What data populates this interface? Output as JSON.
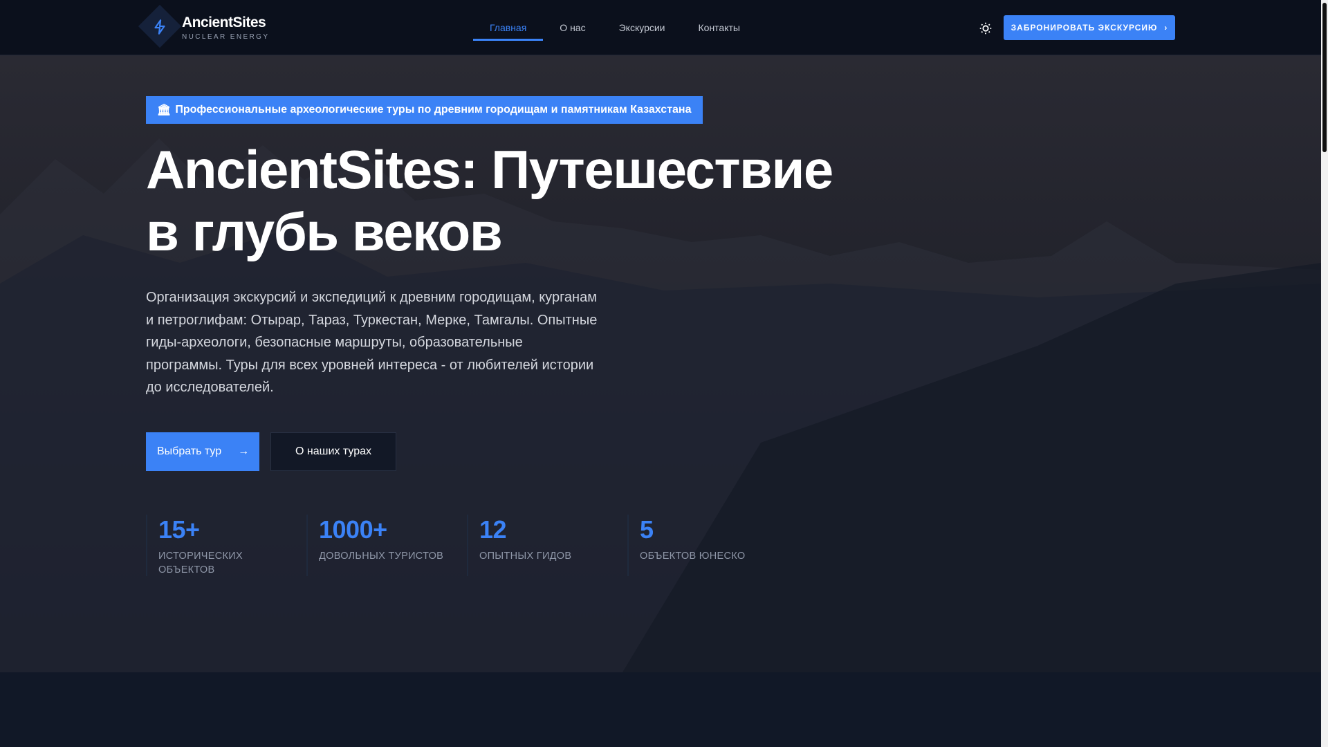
{
  "header": {
    "logo_title": "AncientSites",
    "logo_subtitle": "NUCLEAR ENERGY",
    "nav": [
      {
        "label": "Главная",
        "active": true
      },
      {
        "label": "О нас"
      },
      {
        "label": "Экскурсии"
      },
      {
        "label": "Контакты"
      }
    ],
    "cta_label": "ЗАБРОНИРОВАТЬ ЭКСКУРСИЮ"
  },
  "hero": {
    "badge_icon": "🏛",
    "badge": "Профессиональные археологические туры по древним городищам и памятникам Казахстана",
    "title_line1": "AncientSites: Путешествие",
    "title_line2": "в глубь веков",
    "description": "Организация экскурсий и экспедиций к древним городищам, курганам и петроглифам: Отырар, Тараз, Туркестан, Мерке, Тамгалы. Опытные гиды-археологи, безопасные маршруты, образовательные программы. Туры для всех уровней интереса - от любителей истории до исследователей.",
    "primary_button": "Выбрать тур",
    "secondary_button": "О наших турах",
    "stats": [
      {
        "value": "15+",
        "label": "ИСТОРИЧЕСКИХ ОБЪЕКТОВ"
      },
      {
        "value": "1000+",
        "label": "ДОВОЛЬНЫХ ТУРИСТОВ"
      },
      {
        "value": "12",
        "label": "ОПЫТНЫХ ГИДОВ"
      },
      {
        "value": "5",
        "label": "ОБЪЕКТОВ ЮНЕСКО"
      }
    ]
  },
  "colors": {
    "accent": "#3b82f6",
    "header_bg": "#0b101c",
    "page_bg": "#111827"
  }
}
